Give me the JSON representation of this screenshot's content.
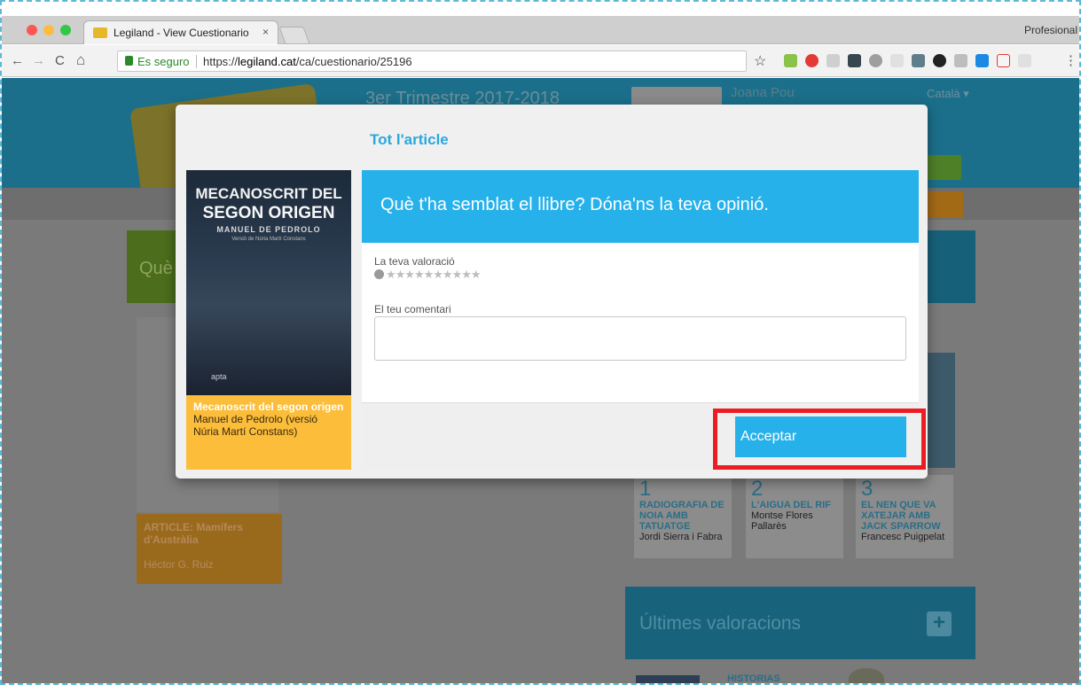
{
  "browser": {
    "tab_title": "Legiland - View Cuestionario",
    "tab_close": "×",
    "profile": "Profesional",
    "secure_label": "Es seguro",
    "url_prefix": "https://",
    "url_domain": "legiland.cat",
    "url_path": "/ca/cuestionario/25196",
    "back": "←",
    "forward": "→",
    "reload": "C",
    "home": "⌂",
    "bookmark": "☆",
    "menu": "⋮"
  },
  "background": {
    "trimester": "3er Trimestre 2017-2018",
    "user_name": "Joana Pou",
    "language": "Català ▾",
    "left_heading": "Què",
    "left_card_title": "ARTICLE: Mamífers d'Austràlia",
    "left_card_author": "Héctor G. Ruiz",
    "books": [
      {
        "num": "1",
        "title": "RADIOGRAFIA DE NOIA AMB TATUATGE",
        "author": "Jordi Sierra i Fabra"
      },
      {
        "num": "2",
        "title": "L'AIGUA DEL RIF",
        "author": "Montse Flores Pallarès"
      },
      {
        "num": "3",
        "title": "EL NEN QUE VA XATEJAR AMB JACK SPARROW",
        "author": "Francesc Puigpelat"
      }
    ],
    "valoracions_title": "Últimes valoracions",
    "valoracions_plus": "+",
    "historias": "HISTORIAS"
  },
  "modal": {
    "title": "Tot l'article",
    "cover": {
      "title_line1": "MECANOSCRIT DEL",
      "title_line2": "SEGON ORIGEN",
      "author": "MANUEL DE PEDROLO",
      "version": "Versió de Núria Martí Constans",
      "publisher": "apta"
    },
    "book_title": "Mecanoscrit del segon origen",
    "book_author": "Manuel de Pedrolo (versió Núria Martí Constans)",
    "question": "Què t'ha semblat el llibre? Dóna'ns la teva opinió.",
    "rating_label": "La teva valoració",
    "rating_value": 0,
    "rating_max": 10,
    "stars": "★★★★★★★★★★",
    "comment_label": "El teu comentari",
    "comment_value": "",
    "accept_label": "Acceptar"
  },
  "colors": {
    "accent": "#27b1ea",
    "highlight": "#ec1c24",
    "cover_caption": "#fbbd3a"
  }
}
